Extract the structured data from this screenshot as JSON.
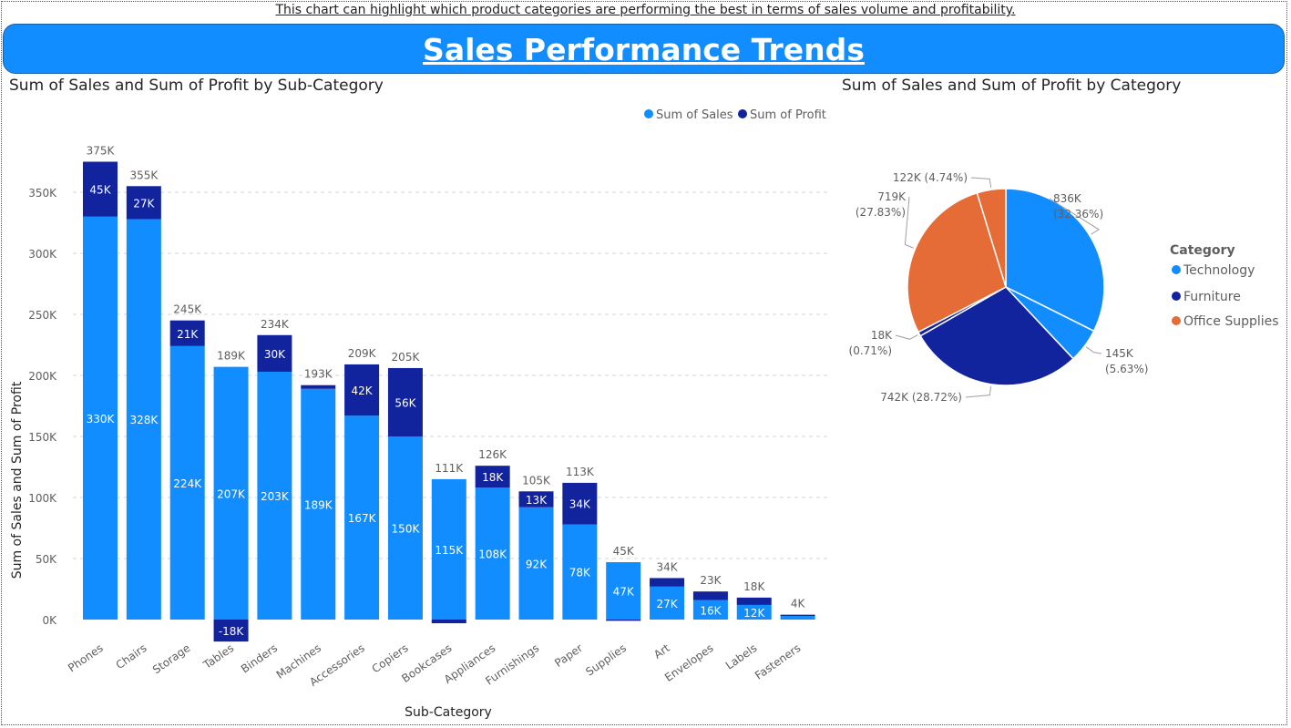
{
  "header": {
    "caption": "This chart can highlight which product categories are performing the best in terms of sales volume and profitability.",
    "title": "Sales Performance Trends"
  },
  "colors": {
    "sales": "#118DFF",
    "profit": "#12239E",
    "office_supplies": "#E66C37",
    "banner": "#118DFF"
  },
  "chart_data": [
    {
      "type": "bar",
      "stacked": true,
      "title": "Sum of Sales and Sum of Profit by Sub-Category",
      "xlabel": "Sub-Category",
      "ylabel": "Sum of Sales and Sum of Profit",
      "ylim": [
        -20000,
        375000
      ],
      "yticks": [
        0,
        50000,
        100000,
        150000,
        200000,
        250000,
        300000,
        350000
      ],
      "ytick_labels": [
        "0K",
        "50K",
        "100K",
        "150K",
        "200K",
        "250K",
        "300K",
        "350K"
      ],
      "grid": true,
      "legend_position": "top-right",
      "categories": [
        "Phones",
        "Chairs",
        "Storage",
        "Tables",
        "Binders",
        "Machines",
        "Accessories",
        "Copiers",
        "Bookcases",
        "Appliances",
        "Furnishings",
        "Paper",
        "Supplies",
        "Art",
        "Envelopes",
        "Labels",
        "Fasteners"
      ],
      "series": [
        {
          "name": "Sum of Sales",
          "values": [
            330000,
            328000,
            224000,
            207000,
            203000,
            189000,
            167000,
            150000,
            115000,
            108000,
            92000,
            78000,
            47000,
            27000,
            16000,
            12000,
            3000
          ],
          "labels": [
            "330K",
            "328K",
            "224K",
            "207K",
            "203K",
            "189K",
            "167K",
            "150K",
            "115K",
            "108K",
            "92K",
            "78K",
            "47K",
            "27K",
            "16K",
            "12K",
            ""
          ]
        },
        {
          "name": "Sum of Profit",
          "values": [
            45000,
            27000,
            21000,
            -18000,
            30000,
            3000,
            42000,
            56000,
            -3000,
            18000,
            13000,
            34000,
            -1000,
            7000,
            7000,
            6000,
            1000
          ],
          "labels": [
            "45K",
            "27K",
            "21K",
            "-18K",
            "30K",
            "",
            "42K",
            "56K",
            "",
            "18K",
            "13K",
            "34K",
            "",
            "",
            "",
            "",
            ""
          ]
        }
      ],
      "totals": [
        "375K",
        "355K",
        "245K",
        "189K",
        "234K",
        "193K",
        "209K",
        "205K",
        "111K",
        "126K",
        "105K",
        "113K",
        "45K",
        "34K",
        "23K",
        "18K",
        "4K"
      ]
    },
    {
      "type": "pie",
      "title": "Sum of Sales and Sum of Profit by Category",
      "legend_title": "Category",
      "legend_position": "right",
      "legend": [
        "Technology",
        "Furniture",
        "Office Supplies"
      ],
      "slices": [
        {
          "category": "Technology",
          "measure": "Sum of Sales",
          "value": 836000,
          "label": "836K",
          "pct": "(32.36%)"
        },
        {
          "category": "Technology",
          "measure": "Sum of Profit",
          "value": 145000,
          "label": "145K",
          "pct": "(5.63%)"
        },
        {
          "category": "Furniture",
          "measure": "Sum of Sales",
          "value": 742000,
          "label": "742K (28.72%)",
          "pct": ""
        },
        {
          "category": "Furniture",
          "measure": "Sum of Profit",
          "value": 18000,
          "label": "18K",
          "pct": "(0.71%)"
        },
        {
          "category": "Office Supplies",
          "measure": "Sum of Sales",
          "value": 719000,
          "label": "719K",
          "pct": "(27.83%)"
        },
        {
          "category": "Office Supplies",
          "measure": "Sum of Profit",
          "value": 122000,
          "label": "122K (4.74%)",
          "pct": ""
        }
      ]
    }
  ]
}
